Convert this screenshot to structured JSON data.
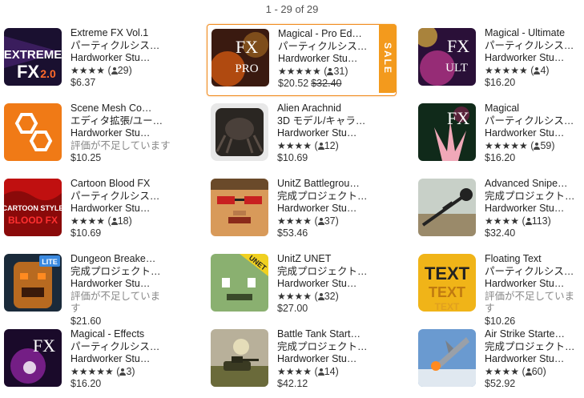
{
  "pagination": {
    "label": "1 - 29 of 29"
  },
  "colors": {
    "sale_accent": "#f39a1d"
  },
  "cards": [
    {
      "title": "Extreme FX Vol.1",
      "category": "パーティクルシス…",
      "publisher": "Hardworker Stu…",
      "stars": "★★★★",
      "count": "29",
      "price": "$6.37",
      "icon": "extreme-fx-thumbnail",
      "thumb_text": "EXTREME FX 2.0"
    },
    {
      "title": "Magical - Pro Ed…",
      "category": "パーティクルシス…",
      "publisher": "Hardworker Stu…",
      "stars": "★★★★★",
      "count": "31",
      "price": "$20.52",
      "old_price": "$32.40",
      "sale": "SALE",
      "icon": "magical-pro-thumbnail",
      "thumb_text": "FX PRO"
    },
    {
      "title": "Magical - Ultimate",
      "category": "パーティクルシス…",
      "publisher": "Hardworker Stu…",
      "stars": "★★★★★",
      "count": "4",
      "price": "$16.20",
      "icon": "magical-ultimate-thumbnail",
      "thumb_text": "FX ULT"
    },
    {
      "title": "Scene Mesh Co…",
      "category": "エディタ拡張/ユー…",
      "publisher": "Hardworker Stu…",
      "note": "評価が不足しています",
      "price": "$10.25",
      "icon": "scene-mesh-thumbnail"
    },
    {
      "title": "Alien Arachnid",
      "category": "3D モデル/キャラ…",
      "publisher": "Hardworker Stu…",
      "stars": "★★★★",
      "count": "12",
      "price": "$10.69",
      "icon": "alien-arachnid-thumbnail"
    },
    {
      "title": "Magical",
      "category": "パーティクルシス…",
      "publisher": "Hardworker Stu…",
      "stars": "★★★★★",
      "count": "59",
      "price": "$16.20",
      "icon": "magical-thumbnail",
      "thumb_text": "FX"
    },
    {
      "title": "Cartoon Blood FX",
      "category": "パーティクルシス…",
      "publisher": "Hardworker Stu…",
      "stars": "★★★★",
      "count": "18",
      "price": "$10.69",
      "icon": "cartoon-blood-thumbnail",
      "thumb_text": "CARTOON STYLE BLOOD FX"
    },
    {
      "title": "UnitZ Battlegrou…",
      "category": "完成プロジェクト…",
      "publisher": "Hardworker Stu…",
      "stars": "★★★★",
      "count": "37",
      "price": "$53.46",
      "icon": "unitz-battleground-thumbnail"
    },
    {
      "title": "Advanced Snipe…",
      "category": "完成プロジェクト…",
      "publisher": "Hardworker Stu…",
      "stars": "★★★★",
      "count": "113",
      "price": "$32.40",
      "icon": "advanced-sniper-thumbnail"
    },
    {
      "title": "Dungeon Breake…",
      "category": "完成プロジェクト…",
      "publisher": "Hardworker Stu…",
      "note": "評価が不足しています",
      "price": "$21.60",
      "icon": "dungeon-breaker-thumbnail",
      "thumb_text": "LITE"
    },
    {
      "title": "UnitZ UNET",
      "category": "完成プロジェクト…",
      "publisher": "Hardworker Stu…",
      "stars": "★★★★",
      "count": "32",
      "price": "$27.00",
      "icon": "unitz-unet-thumbnail",
      "thumb_text": "UNET"
    },
    {
      "title": "Floating Text",
      "category": "パーティクルシス…",
      "publisher": "Hardworker Stu…",
      "note": "評価が不足しています",
      "price": "$10.26",
      "icon": "floating-text-thumbnail",
      "thumb_text": "TEXT TEXT"
    },
    {
      "title": "Magical - Effects",
      "category": "パーティクルシス…",
      "publisher": "Hardworker Stu…",
      "stars": "★★★★★",
      "count": "3",
      "price": "$16.20",
      "icon": "magical-effects-thumbnail",
      "thumb_text": "FX"
    },
    {
      "title": "Battle Tank Start…",
      "category": "完成プロジェクト…",
      "publisher": "Hardworker Stu…",
      "stars": "★★★★",
      "count": "14",
      "price": "$42.12",
      "icon": "battle-tank-thumbnail"
    },
    {
      "title": "Air Strike Starte…",
      "category": "完成プロジェクト…",
      "publisher": "Hardworker Stu…",
      "stars": "★★★★",
      "count": "60",
      "price": "$52.92",
      "icon": "air-strike-thumbnail"
    }
  ]
}
